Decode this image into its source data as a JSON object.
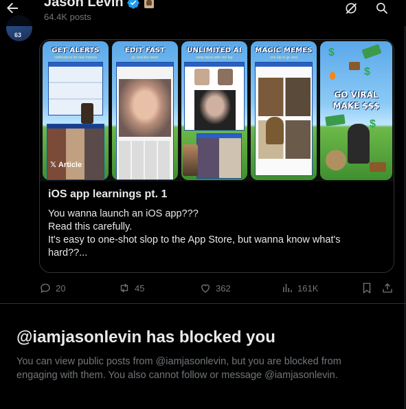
{
  "header": {
    "name": "Jason Levin",
    "posts_count": "64.4K posts"
  },
  "card": {
    "panels": [
      {
        "title": "GET ALERTS",
        "subtitle": "notifications for new memes"
      },
      {
        "title": "EDIT FAST",
        "subtitle": "go viral like never"
      },
      {
        "title": "UNLIMITED AI",
        "subtitle": "swap faces with one tap"
      },
      {
        "title": "MAGIC MEMES",
        "subtitle": "one tap to go viral"
      },
      {
        "title": "GO VIRAL MAKE $$$",
        "subtitle": ""
      }
    ],
    "badge_label": "Article",
    "title": "iOS app learnings pt. 1",
    "body_lines": [
      "You wanna launch an iOS app???",
      "Read this carefully.",
      "It's easy to one-shot slop to the App Store, but wanna know what's",
      "hard??..."
    ]
  },
  "actions": {
    "replies": "20",
    "reposts": "45",
    "likes": "362",
    "views": "161K"
  },
  "blocked": {
    "title": "@iamjasonlevin has blocked you",
    "line1": "You can view public posts from @iamjasonlevin, but you are blocked from",
    "line2": "engaging with them. You also cannot follow or message @iamjasonlevin."
  },
  "colors": {
    "background": "#000000",
    "text_primary": "#e7e9ea",
    "text_secondary": "#71767b",
    "border": "#2f3336",
    "verified": "#1d9bf0"
  }
}
